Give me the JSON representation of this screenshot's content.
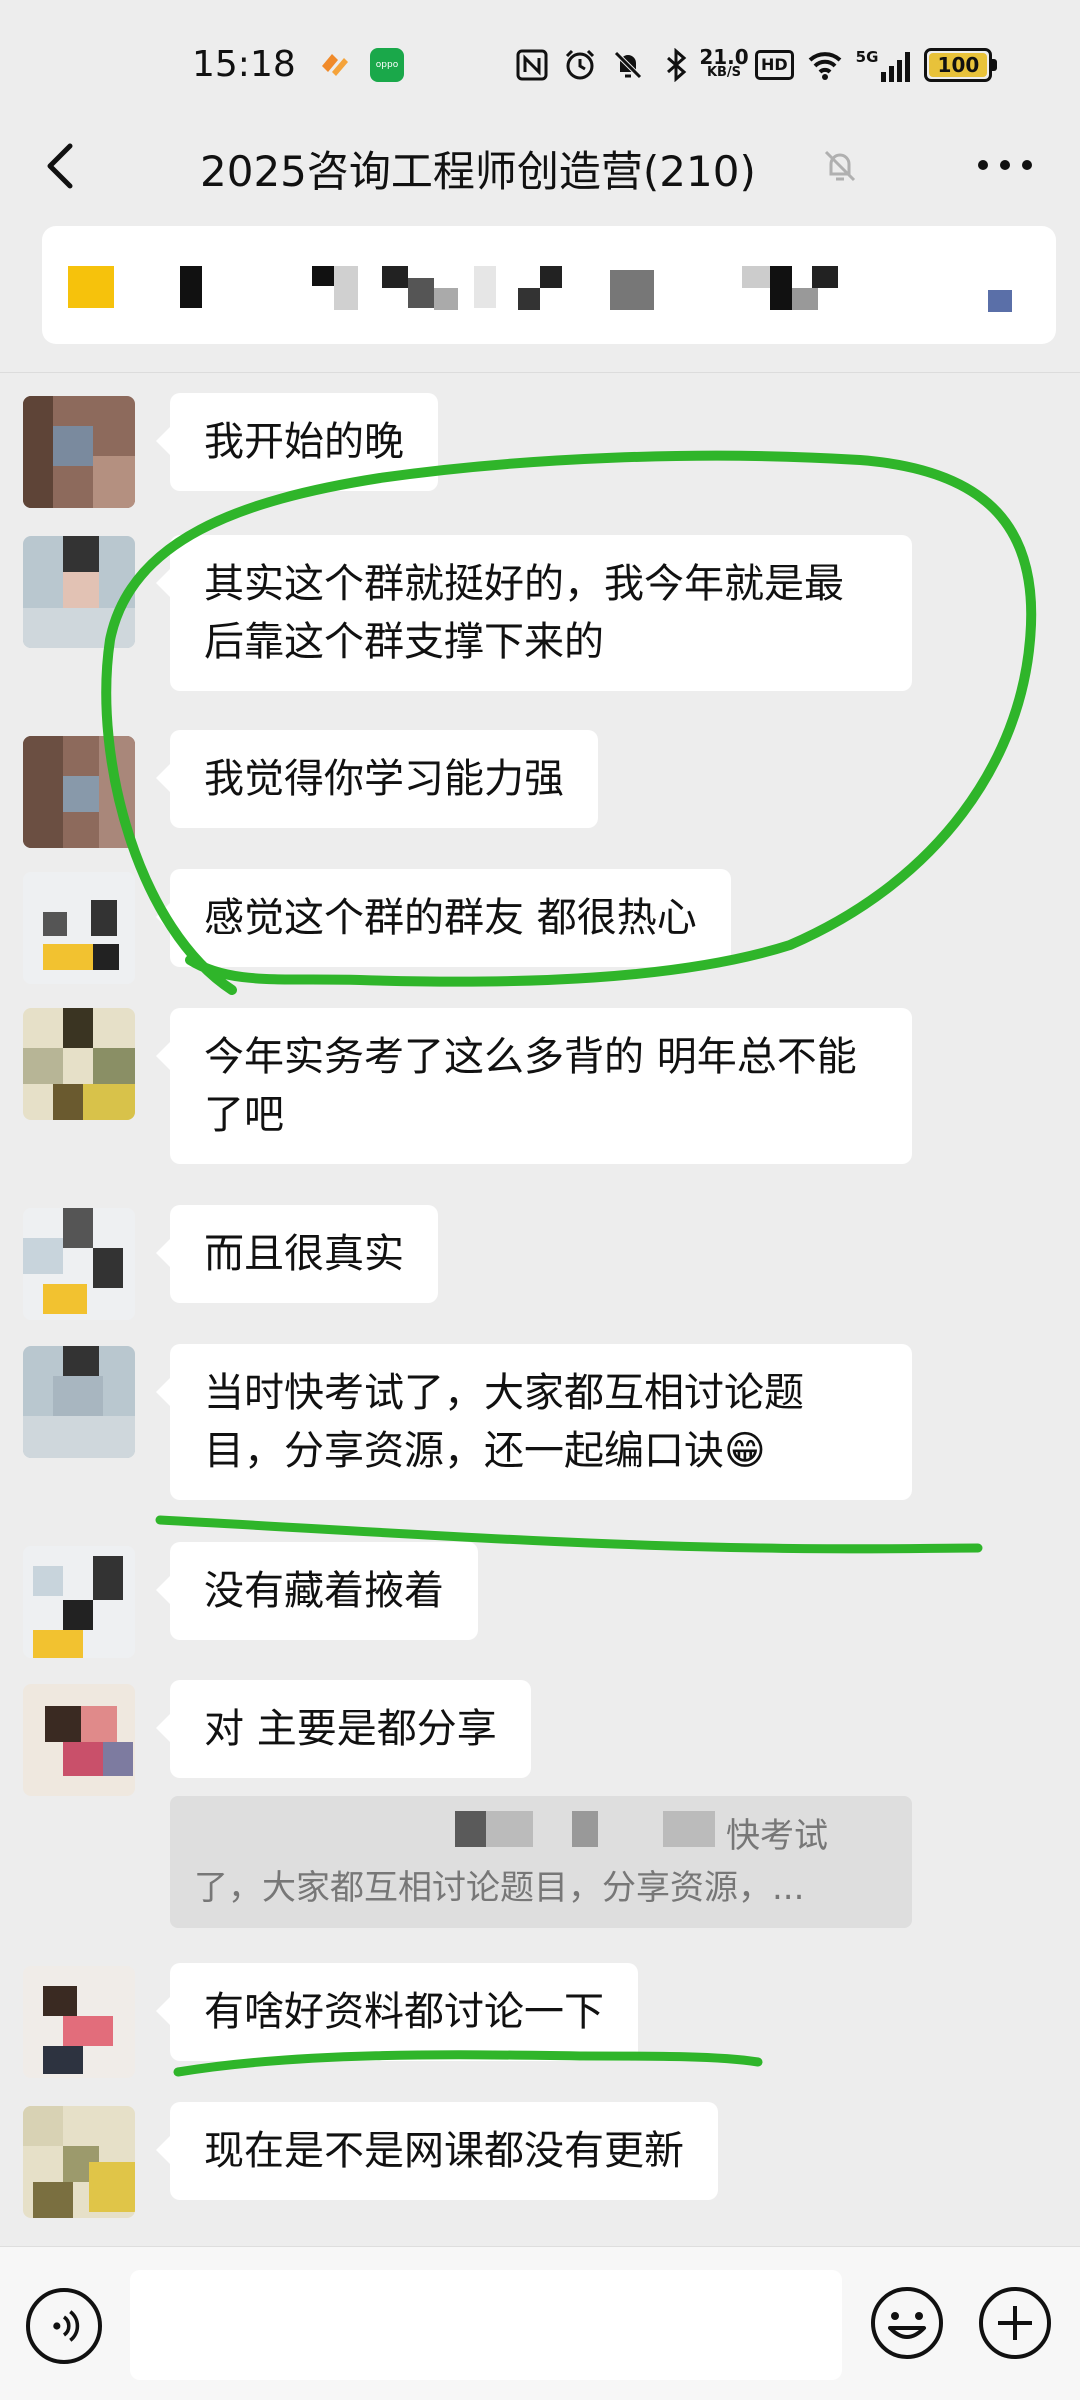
{
  "status_bar": {
    "time": "15:18",
    "network_speed_value": "21.0",
    "network_speed_unit": "KB/S",
    "hd": "HD",
    "signal": "5G",
    "battery": "100",
    "battery_level": 1.0,
    "icons": [
      "app-icon-orange",
      "oppo-app-icon",
      "nfc-icon",
      "alarm-icon",
      "mute-bell-icon",
      "bluetooth-icon",
      "wifi-icon",
      "cell-signal-icon",
      "battery-icon"
    ]
  },
  "header": {
    "title": "2025咨询工程师创造营(210)",
    "icons": [
      "back-icon",
      "mute-icon",
      "more-icon"
    ]
  },
  "messages": [
    {
      "text": "我开始的晚"
    },
    {
      "text": "其实这个群就挺好的，我今年就是最后靠这个群支撑下来的"
    },
    {
      "text": "我觉得你学习能力强"
    },
    {
      "text": "感觉这个群的群友 都很热心"
    },
    {
      "text": "今年实务考了这么多背的  明年总不能了吧"
    },
    {
      "text": "而且很真实"
    },
    {
      "text": "当时快考试了，大家都互相讨论题目，分享资源，还一起编口诀😁"
    },
    {
      "text": "没有藏着掖着"
    },
    {
      "text": "对 主要是都分享"
    },
    {
      "text": "有啥好资料都讨论一下"
    },
    {
      "text": "现在是不是网课都没有更新"
    }
  ],
  "quote": {
    "line1": "快考试",
    "line2": "了，大家都互相讨论题目，分享资源，..."
  },
  "bottom_bar": {
    "icons": [
      "voice-icon",
      "emoji-icon",
      "plus-icon"
    ]
  },
  "colors": {
    "background": "#ededed",
    "bubble": "#ffffff",
    "annotation_green": "#2fb52a"
  }
}
